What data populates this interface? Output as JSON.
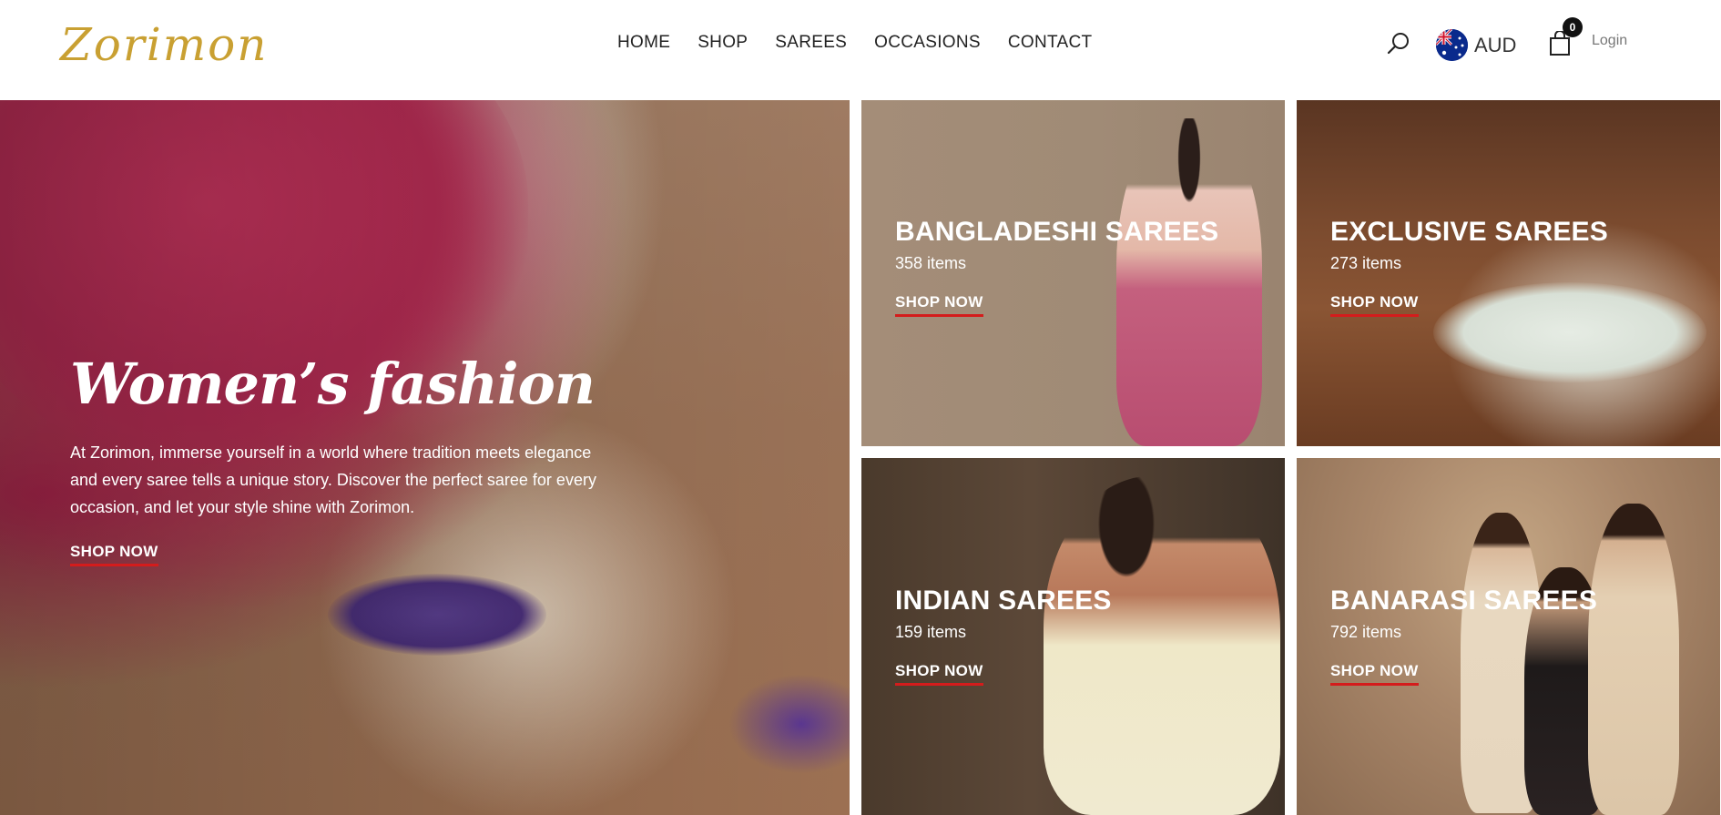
{
  "header": {
    "logo_text": "Zorimon",
    "nav": [
      "HOME",
      "SHOP",
      "SAREES",
      "OCCASIONS",
      "CONTACT"
    ],
    "currency": "AUD",
    "cart_count": "0",
    "login_label": "Login",
    "icons": {
      "search": "search-icon",
      "cart": "shopping-bag-icon",
      "flag": "australia-flag-icon"
    },
    "colors": {
      "logo": "#c9a032",
      "link_underline": "#d41c1c"
    }
  },
  "hero": {
    "title": "Women’s fashion",
    "text": "At Zorimon, immerse yourself in a world where tradition meets elegance and every saree tells a unique story. Discover the perfect saree for every occasion, and let your style shine with Zorimon.",
    "cta": "SHOP NOW"
  },
  "categories": [
    {
      "title": "BANGLADESHI SAREES",
      "count": "358 items",
      "cta": "SHOP NOW"
    },
    {
      "title": "EXCLUSIVE SAREES",
      "count": "273 items",
      "cta": "SHOP NOW"
    },
    {
      "title": "INDIAN SAREES",
      "count": "159 items",
      "cta": "SHOP NOW"
    },
    {
      "title": "BANARASI SAREES",
      "count": "792 items",
      "cta": "SHOP NOW"
    }
  ]
}
